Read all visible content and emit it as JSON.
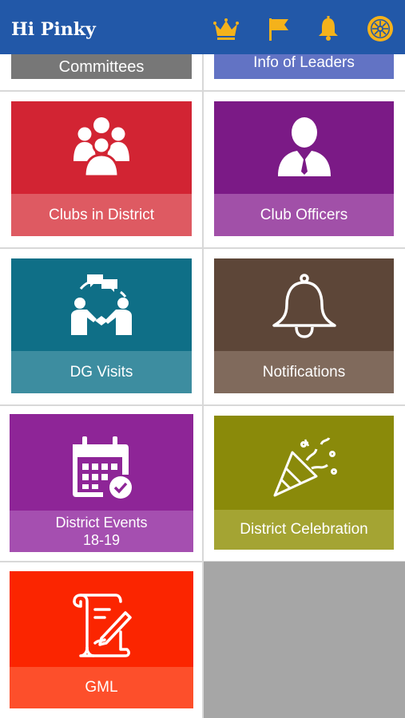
{
  "header": {
    "greeting": "Hi Pinky",
    "icons": [
      "crown-icon",
      "flag-icon",
      "bell-icon",
      "rotary-wheel-icon"
    ],
    "background": "#2258a8",
    "icon_color": "#f4b21b"
  },
  "tiles": [
    {
      "label": "Committees",
      "icon": "",
      "color": "#6f6f6f",
      "label_color": "#777777"
    },
    {
      "label": "Info of Leaders",
      "icon": "",
      "color": "#5a6bc4",
      "label_color": "#6273c4"
    },
    {
      "label": "Clubs in District",
      "icon": "group-icon",
      "color": "#d22433",
      "label_color": "#de5a62"
    },
    {
      "label": "Club Officers",
      "icon": "officer-icon",
      "color": "#7b1a86",
      "label_color": "#a150a8"
    },
    {
      "label": "DG Visits",
      "icon": "handshake-chat-icon",
      "color": "#0f6f87",
      "label_color": "#3d8da0"
    },
    {
      "label": "Notifications",
      "icon": "bell-icon",
      "color": "#5d4638",
      "label_color": "#806a5c"
    },
    {
      "label": "District Events\n18-19",
      "icon": "calendar-check-icon",
      "color": "#8e2597",
      "label_color": "#a54fb0"
    },
    {
      "label": "District Celebration",
      "icon": "party-popper-icon",
      "color": "#8a8a0a",
      "label_color": "#a4a433"
    },
    {
      "label": "GML",
      "icon": "scroll-pen-icon",
      "color": "#fb2500",
      "label_color": "#fd4f2b"
    }
  ]
}
